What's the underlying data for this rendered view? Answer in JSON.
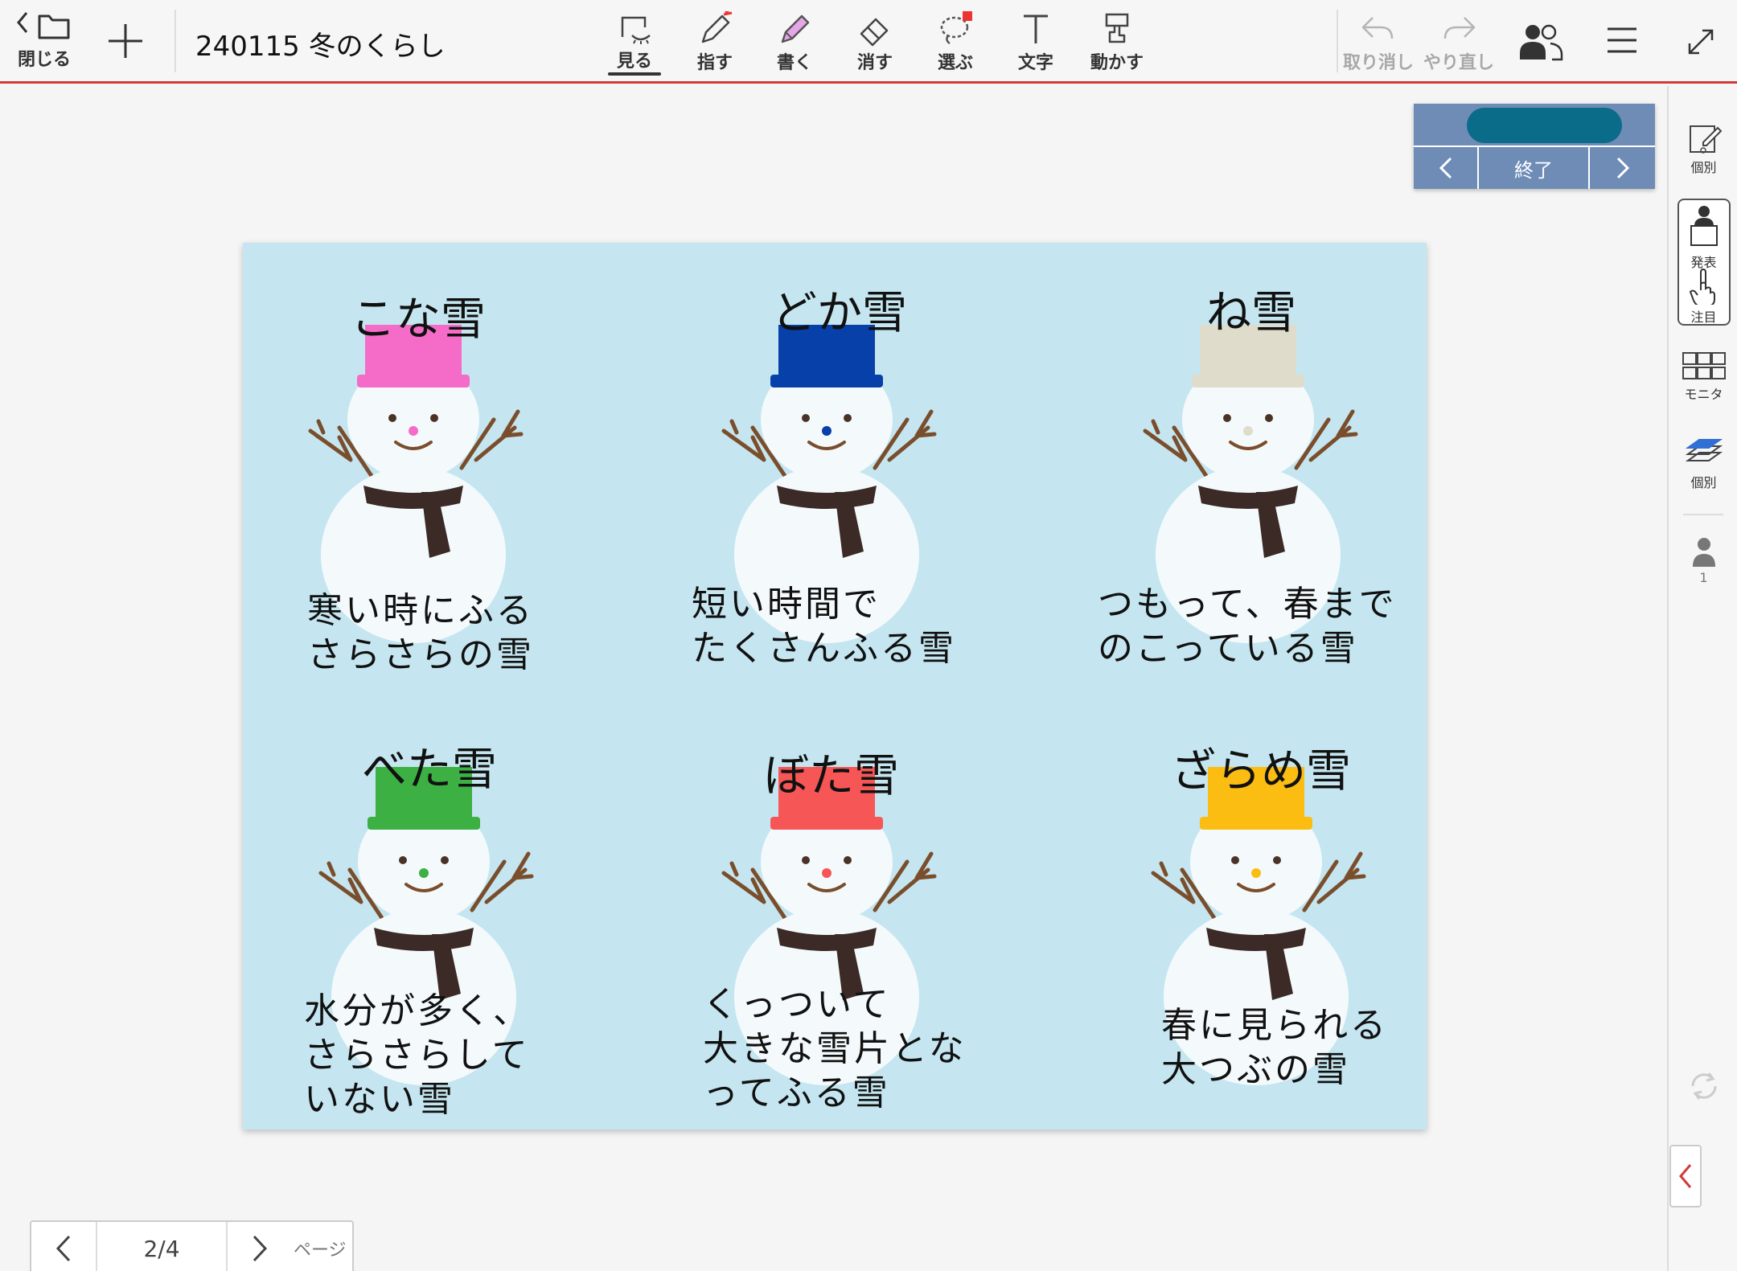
{
  "toolbar": {
    "close_label": "閉じる",
    "doc_title": "240115 冬のくらし",
    "tools": [
      {
        "label": "見る",
        "icon": "view-icon",
        "active": true
      },
      {
        "label": "指す",
        "icon": "pointer-pen-icon"
      },
      {
        "label": "書く",
        "icon": "pencil-icon"
      },
      {
        "label": "消す",
        "icon": "eraser-icon"
      },
      {
        "label": "選ぶ",
        "icon": "lasso-select-icon"
      },
      {
        "label": "文字",
        "icon": "text-icon"
      },
      {
        "label": "動かす",
        "icon": "move-hand-icon"
      }
    ],
    "undo_label": "取り消し",
    "redo_label": "やり直し",
    "accent_color": "#d23a3a"
  },
  "controls": {
    "end_label": "終了",
    "pill_color": "#0a6c88",
    "panel_color": "#6f8cb7"
  },
  "sidebar": {
    "items": [
      {
        "label": "個別",
        "icon": "individual-edit-icon"
      },
      {
        "label": "発表",
        "icon": "presentation-icon"
      },
      {
        "label": "注目",
        "icon": "attention-hand-icon"
      },
      {
        "label": "モニタ",
        "icon": "monitor-grid-icon"
      },
      {
        "label": "個別",
        "icon": "layers-icon"
      }
    ],
    "user_count": "1"
  },
  "slide": {
    "background": "#c5e6f0",
    "snowmen": [
      {
        "title": "こな雪",
        "desc": "寒い時にふる\nさらさらの雪",
        "hat_color": "#f46cc8",
        "nose_color": "#f46cc8"
      },
      {
        "title": "どか雪",
        "desc": "短い時間で\nたくさんふる雪",
        "hat_color": "#0640a8",
        "nose_color": "#0640a8"
      },
      {
        "title": "ね雪",
        "desc": "つもって、春まで\nのこっている雪",
        "hat_color": "#e0dccb",
        "nose_color": "#e0dccb"
      },
      {
        "title": "べた雪",
        "desc": "水分が多く、\nさらさらして\nいない雪",
        "hat_color": "#3cb043",
        "nose_color": "#3cb043"
      },
      {
        "title": "ぼた雪",
        "desc": "くっついて\n大きな雪片とな\nってふる雪",
        "hat_color": "#f75656",
        "nose_color": "#f75656"
      },
      {
        "title": "ざらめ雪",
        "desc": "春に見られる\n大つぶの雪",
        "hat_color": "#fbbd12",
        "nose_color": "#fbbd12"
      }
    ]
  },
  "pager": {
    "current": "2/4",
    "page_word": "ページ"
  }
}
